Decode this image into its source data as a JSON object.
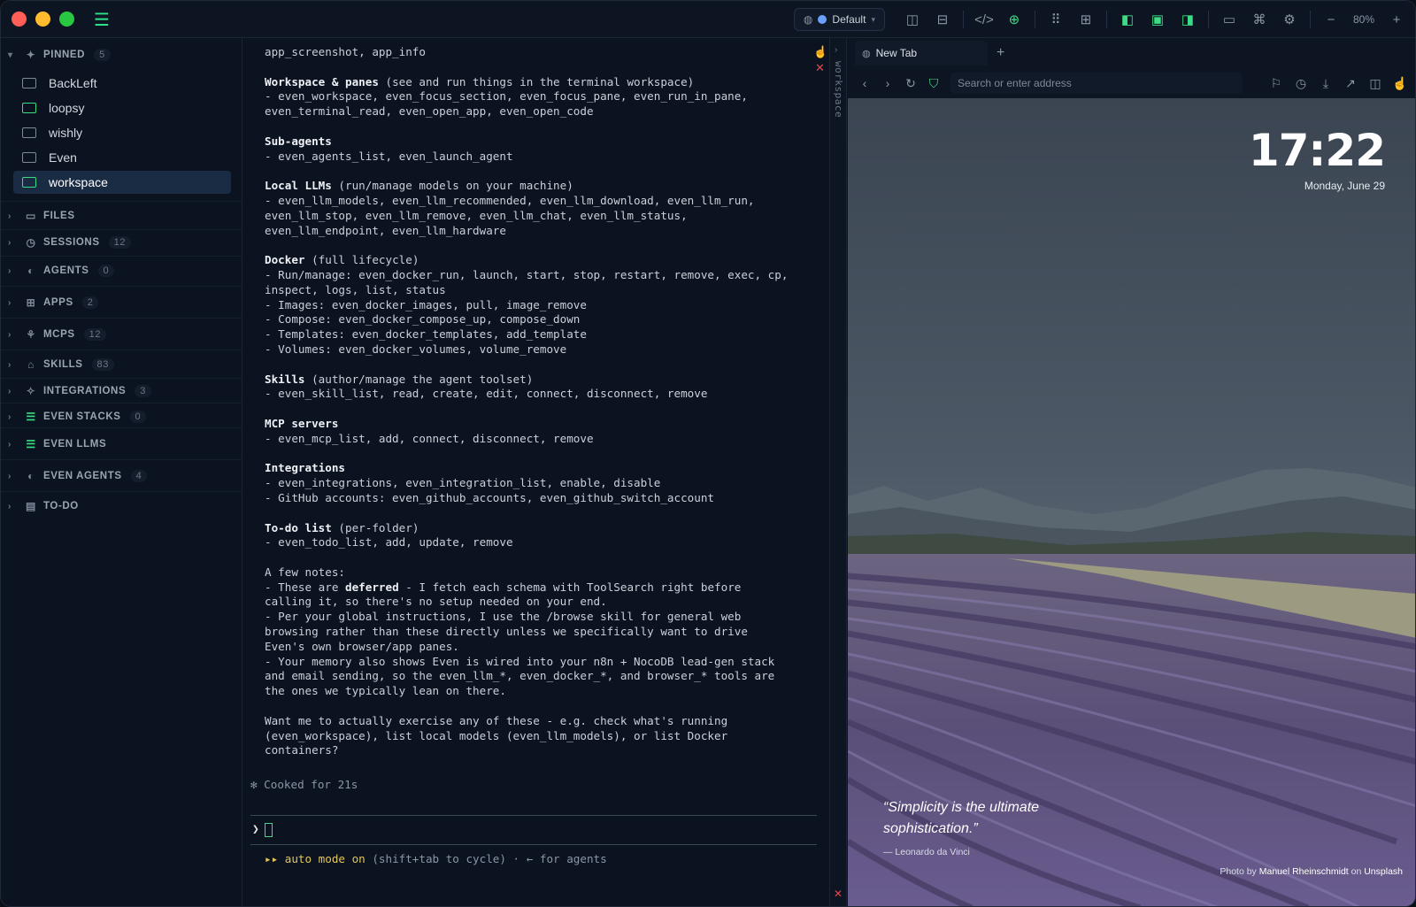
{
  "titlebar": {
    "profile_label": "Default",
    "zoom_level": "80%"
  },
  "sidebar": {
    "pinned": {
      "label": "PINNED",
      "count": "5"
    },
    "pinned_items": [
      {
        "label": "BackLeft"
      },
      {
        "label": "loopsy"
      },
      {
        "label": "wishly"
      },
      {
        "label": "Even"
      },
      {
        "label": "workspace"
      }
    ],
    "sections": [
      {
        "label": "FILES",
        "count": ""
      },
      {
        "label": "SESSIONS",
        "count": "12"
      },
      {
        "label": "AGENTS",
        "count": "0"
      },
      {
        "label": "APPS",
        "count": "2"
      },
      {
        "label": "MCPS",
        "count": "12"
      },
      {
        "label": "SKILLS",
        "count": "83"
      },
      {
        "label": "INTEGRATIONS",
        "count": "3"
      },
      {
        "label": "EVEN STACKS",
        "count": "0"
      },
      {
        "label": "EVEN LLMS",
        "count": ""
      },
      {
        "label": "EVEN AGENTS",
        "count": "4"
      },
      {
        "label": "TO-DO",
        "count": ""
      }
    ]
  },
  "terminal": {
    "lines": [
      {
        "bold": "",
        "rest": "app_screenshot, app_info"
      },
      {
        "bold": "",
        "rest": ""
      },
      {
        "bold": "Workspace & panes",
        "rest": " (see and run things in the terminal workspace)"
      },
      {
        "bold": "",
        "rest": "- even_workspace, even_focus_section, even_focus_pane, even_run_in_pane,"
      },
      {
        "bold": "",
        "rest": "even_terminal_read, even_open_app, even_open_code"
      },
      {
        "bold": "",
        "rest": ""
      },
      {
        "bold": "Sub-agents",
        "rest": ""
      },
      {
        "bold": "",
        "rest": "- even_agents_list, even_launch_agent"
      },
      {
        "bold": "",
        "rest": ""
      },
      {
        "bold": "Local LLMs",
        "rest": " (run/manage models on your machine)"
      },
      {
        "bold": "",
        "rest": "- even_llm_models, even_llm_recommended, even_llm_download, even_llm_run,"
      },
      {
        "bold": "",
        "rest": "even_llm_stop, even_llm_remove, even_llm_chat, even_llm_status,"
      },
      {
        "bold": "",
        "rest": "even_llm_endpoint, even_llm_hardware"
      },
      {
        "bold": "",
        "rest": ""
      },
      {
        "bold": "Docker",
        "rest": " (full lifecycle)"
      },
      {
        "bold": "",
        "rest": "- Run/manage: even_docker_run, launch, start, stop, restart, remove, exec, cp,"
      },
      {
        "bold": "",
        "rest": "inspect, logs, list, status"
      },
      {
        "bold": "",
        "rest": "- Images: even_docker_images, pull, image_remove"
      },
      {
        "bold": "",
        "rest": "- Compose: even_docker_compose_up, compose_down"
      },
      {
        "bold": "",
        "rest": "- Templates: even_docker_templates, add_template"
      },
      {
        "bold": "",
        "rest": "- Volumes: even_docker_volumes, volume_remove"
      },
      {
        "bold": "",
        "rest": ""
      },
      {
        "bold": "Skills",
        "rest": " (author/manage the agent toolset)"
      },
      {
        "bold": "",
        "rest": "- even_skill_list, read, create, edit, connect, disconnect, remove"
      },
      {
        "bold": "",
        "rest": ""
      },
      {
        "bold": "MCP servers",
        "rest": ""
      },
      {
        "bold": "",
        "rest": "- even_mcp_list, add, connect, disconnect, remove"
      },
      {
        "bold": "",
        "rest": ""
      },
      {
        "bold": "Integrations",
        "rest": ""
      },
      {
        "bold": "",
        "rest": "- even_integrations, even_integration_list, enable, disable"
      },
      {
        "bold": "",
        "rest": "- GitHub accounts: even_github_accounts, even_github_switch_account"
      },
      {
        "bold": "",
        "rest": ""
      },
      {
        "bold": "To-do list",
        "rest": " (per-folder)"
      },
      {
        "bold": "",
        "rest": "- even_todo_list, add, update, remove"
      },
      {
        "bold": "",
        "rest": ""
      },
      {
        "bold": "",
        "rest": "A few notes:"
      },
      {
        "pre": "- These are ",
        "bold": "deferred",
        "rest": " - I fetch each schema with ToolSearch right before"
      },
      {
        "bold": "",
        "rest": "calling it, so there's no setup needed on your end."
      },
      {
        "bold": "",
        "rest": "- Per your global instructions, I use the /browse skill for general web"
      },
      {
        "bold": "",
        "rest": "browsing rather than these directly unless we specifically want to drive"
      },
      {
        "bold": "",
        "rest": "Even's own browser/app panes."
      },
      {
        "bold": "",
        "rest": "- Your memory also shows Even is wired into your n8n + NocoDB lead-gen stack"
      },
      {
        "bold": "",
        "rest": "and email sending, so the even_llm_*, even_docker_*, and browser_* tools are"
      },
      {
        "bold": "",
        "rest": "the ones we typically lean on there."
      },
      {
        "bold": "",
        "rest": ""
      },
      {
        "bold": "",
        "rest": "Want me to actually exercise any of these - e.g. check what's running"
      },
      {
        "bold": "",
        "rest": "(even_workspace), list local models (even_llm_models), or list Docker"
      },
      {
        "bold": "",
        "rest": "containers?"
      }
    ],
    "cooked": "✻ Cooked for 21s",
    "prompt_symbol": "❯",
    "auto_mode_arrows": "▸▸ auto mode on",
    "auto_mode_hint": " (shift+tab to cycle) · ← for agents"
  },
  "workspace_strip": {
    "label": "workspace"
  },
  "browser": {
    "tab_label": "New Tab",
    "address_placeholder": "Search or enter address",
    "clock": "17:22",
    "date": "Monday, June 29",
    "quote": "“Simplicity is the ultimate sophistication.”",
    "quote_author": "— Leonardo da Vinci",
    "credit_prefix": "Photo by ",
    "credit_photographer": "Manuel Rheinschmidt",
    "credit_mid": " on ",
    "credit_site": "Unsplash"
  },
  "colors": {
    "accent_green": "#3ddc84",
    "close_red": "#e5484d",
    "auto_yellow": "#e3c55a",
    "active_item": "#1a2b44"
  }
}
